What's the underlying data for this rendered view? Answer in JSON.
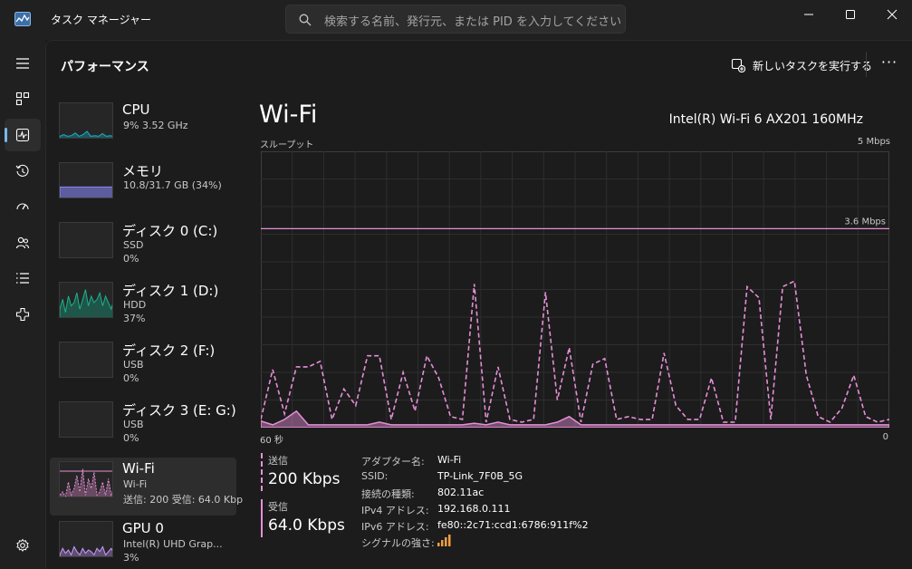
{
  "window": {
    "title": "タスク マネージャー",
    "search_placeholder": "検索する名前、発行元、または PID を入力してください"
  },
  "header": {
    "page_title": "パフォーマンス",
    "run_new_task": "新しいタスクを実行する",
    "more": "···"
  },
  "nav": {
    "items": [
      {
        "icon": "hamburger-menu-icon"
      },
      {
        "icon": "processes-icon"
      },
      {
        "icon": "performance-icon",
        "active": true
      },
      {
        "icon": "app-history-icon"
      },
      {
        "icon": "startup-apps-icon"
      },
      {
        "icon": "users-icon"
      },
      {
        "icon": "details-icon"
      },
      {
        "icon": "services-icon"
      },
      {
        "icon": "settings-icon"
      }
    ]
  },
  "resources": [
    {
      "name": "CPU",
      "line1": "9%  3.52 GHz",
      "line2": ""
    },
    {
      "name": "メモリ",
      "line1": "10.8/31.7 GB (34%)",
      "line2": ""
    },
    {
      "name": "ディスク 0 (C:)",
      "line1": "SSD",
      "line2": "0%"
    },
    {
      "name": "ディスク 1 (D:)",
      "line1": "HDD",
      "line2": "37%"
    },
    {
      "name": "ディスク 2 (F:)",
      "line1": "USB",
      "line2": "0%"
    },
    {
      "name": "ディスク 3 (E: G:)",
      "line1": "USB",
      "line2": "0%"
    },
    {
      "name": "Wi-Fi",
      "line1": "Wi-Fi",
      "line2": "送信: 200 受信: 64.0 Kbp",
      "selected": true
    },
    {
      "name": "GPU 0",
      "line1": "Intel(R) UHD Grap...",
      "line2": "3%"
    }
  ],
  "detail": {
    "title": "Wi-Fi",
    "adapter": "Intel(R) Wi-Fi 6 AX201 160MHz",
    "throughput_label": "スループット",
    "max_label": "5 Mbps",
    "ref_label": "3.6 Mbps",
    "x_left": "60 秒",
    "x_right": "0",
    "send_label": "送信",
    "send_value": "200 Kbps",
    "recv_label": "受信",
    "recv_value": "64.0 Kbps",
    "properties": [
      {
        "k": "アダプター名:",
        "v": "Wi-Fi"
      },
      {
        "k": "SSID:",
        "v": "TP-Link_7F0B_5G"
      },
      {
        "k": "接続の種類:",
        "v": "802.11ac"
      },
      {
        "k": "IPv4 アドレス:",
        "v": "192.168.0.111"
      },
      {
        "k": "IPv6 アドレス:",
        "v": "fe80::2c71:ccd1:6786:911f%2"
      },
      {
        "k": "シグナルの強さ:",
        "v": ""
      }
    ],
    "signal_bars": 4
  },
  "chart_data": {
    "type": "line",
    "x_range": [
      60,
      0
    ],
    "ylim": [
      0,
      5
    ],
    "y_unit": "Mbps",
    "reference_line": 3.6,
    "series": [
      {
        "name": "送信",
        "style": "dashed",
        "color": "#e58fd6",
        "values": [
          0.15,
          1.05,
          0.25,
          1.1,
          1.1,
          1.2,
          0.15,
          0.7,
          0.4,
          1.3,
          1.3,
          0.15,
          1.0,
          0.3,
          1.3,
          0.9,
          0.2,
          0.15,
          2.6,
          0.1,
          1.1,
          0.15,
          0.1,
          0.15,
          2.45,
          0.5,
          1.45,
          0.1,
          1.15,
          1.25,
          0.15,
          0.2,
          0.15,
          0.15,
          1.35,
          0.4,
          0.15,
          0.15,
          0.9,
          0.1,
          0.1,
          2.55,
          2.35,
          0.15,
          2.55,
          2.65,
          0.95,
          0.2,
          0.1,
          0.35,
          0.95,
          0.2,
          0.1,
          0.15
        ]
      },
      {
        "name": "受信",
        "style": "solid",
        "color": "#e58fd6",
        "values": [
          0.12,
          0.05,
          0.15,
          0.3,
          0.05,
          0.05,
          0.05,
          0.05,
          0.05,
          0.05,
          0.1,
          0.05,
          0.05,
          0.05,
          0.05,
          0.05,
          0.05,
          0.05,
          0.08,
          0.05,
          0.1,
          0.05,
          0.05,
          0.05,
          0.05,
          0.1,
          0.2,
          0.05,
          0.05,
          0.05,
          0.05,
          0.05,
          0.05,
          0.05,
          0.05,
          0.05,
          0.05,
          0.05,
          0.05,
          0.05,
          0.05,
          0.05,
          0.05,
          0.05,
          0.05,
          0.05,
          0.05,
          0.05,
          0.05,
          0.05,
          0.05,
          0.05,
          0.05,
          0.05
        ]
      }
    ]
  },
  "thumbnails": {
    "cpu": [
      0.1,
      0.15,
      0.1,
      0.12,
      0.2,
      0.1,
      0.15,
      0.25,
      0.1,
      0.12,
      0.1,
      0.18,
      0.1,
      0.12,
      0.1
    ],
    "disk1": [
      0.3,
      0.6,
      0.2,
      0.7,
      0.4,
      0.5,
      0.8,
      0.3,
      0.6,
      0.9,
      0.4,
      0.7,
      0.5,
      0.6,
      0.8,
      0.4,
      0.7,
      0.5,
      0.3,
      0.6
    ],
    "wifi": [
      0.1,
      0.2,
      0.05,
      0.5,
      0.1,
      0.3,
      0.7,
      0.2,
      0.9,
      0.1,
      0.6,
      0.3,
      0.8,
      0.1,
      0.2,
      0.5,
      0.1,
      0.6,
      0.1,
      0.3
    ],
    "gpu": [
      0.1,
      0.3,
      0.15,
      0.25,
      0.1,
      0.35,
      0.2,
      0.1,
      0.3,
      0.15,
      0.25,
      0.2,
      0.1,
      0.3,
      0.2,
      0.35,
      0.1,
      0.2,
      0.3,
      0.15
    ],
    "memory_fraction": 0.34
  },
  "colors": {
    "cpu": "#17b2c9",
    "memory": "#8b88ff",
    "disk": "#18b28e",
    "wifi": "#e58fd6",
    "gpu": "#c99bff",
    "accent": "#76b9ed"
  }
}
